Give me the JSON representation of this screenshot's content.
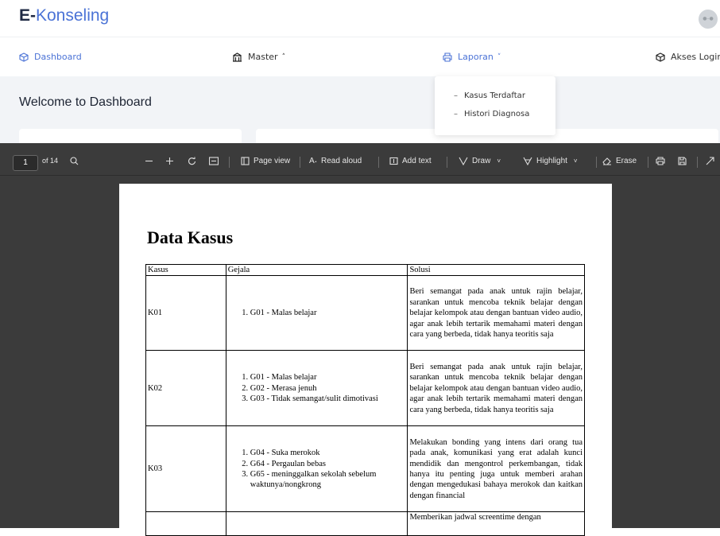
{
  "app": {
    "brand_prefix": "E-",
    "brand_name": "Konseling",
    "avatar_text": "●–●"
  },
  "nav": {
    "dashboard": "Dashboard",
    "master": "Master",
    "laporan": "Laporan",
    "akses_login": "Akses Login"
  },
  "welcome": "Welcome to Dashboard",
  "laporan_menu": [
    "Kasus Terdaftar",
    "Histori Diagnosa"
  ],
  "viewer": {
    "page_number": "1",
    "page_total": "of 14",
    "page_view": "Page view",
    "read_aloud": "Read aloud",
    "add_text": "Add text",
    "draw": "Draw",
    "highlight": "Highlight",
    "erase": "Erase"
  },
  "document": {
    "title": "Data Kasus",
    "headers": [
      "Kasus",
      "Gejala",
      "Solusi"
    ],
    "rows": [
      {
        "kasus": "K01",
        "gejala": [
          "G01 - Malas belajar"
        ],
        "solusi": "Beri semangat pada anak untuk rajin belajar, sarankan untuk mencoba teknik belajar dengan belajar kelompok atau dengan bantuan video audio, agar anak lebih tertarik memahami materi dengan cara yang berbeda, tidak hanya teoritis saja"
      },
      {
        "kasus": "K02",
        "gejala": [
          "G01 - Malas belajar",
          "G02 - Merasa jenuh",
          "G03 - Tidak semangat/sulit dimotivasi"
        ],
        "solusi": "Beri semangat pada anak untuk rajin belajar, sarankan untuk mencoba teknik belajar dengan belajar kelompok atau dengan bantuan video audio, agar anak lebih tertarik memahami materi dengan cara yang berbeda, tidak hanya teoritis saja"
      },
      {
        "kasus": "K03",
        "gejala": [
          "G04 - Suka merokok",
          "G64 - Pergaulan bebas",
          "G65 - meninggalkan sekolah sebelum waktunya/nongkrong"
        ],
        "solusi": "Melakukan bonding yang intens dari orang tua pada anak, komunikasi yang erat adalah kunci mendidik dan mengontrol perkembangan, tidak hanya itu penting juga untuk memberi arahan dengan mengedukasi bahaya merokok dan kaitkan dengan financial"
      },
      {
        "kasus": "",
        "gejala": [],
        "solusi": "Memberikan jadwal screentime dengan"
      }
    ]
  }
}
